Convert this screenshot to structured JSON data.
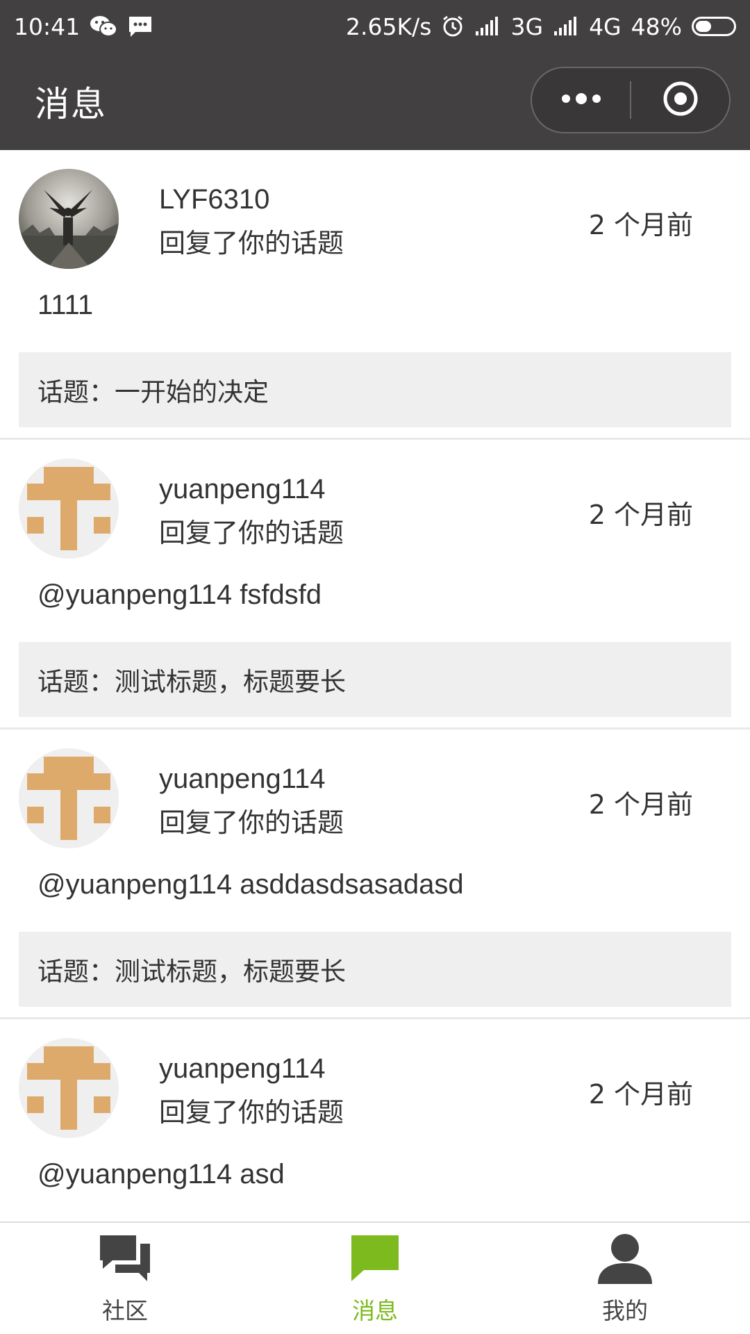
{
  "status_bar": {
    "time": "10:41",
    "net_speed": "2.65K/s",
    "network_1": "3G",
    "network_2": "4G",
    "battery": "48%",
    "battery_level": 0.48,
    "icons": [
      "wechat-icon",
      "sms-icon",
      "alarm-icon",
      "signal-icon",
      "signal-icon"
    ]
  },
  "header": {
    "title": "消息",
    "more_icon": "more-dots-icon",
    "close_icon": "target-circle-icon"
  },
  "messages": [
    {
      "user": "LYF6310",
      "action": "回复了你的话题",
      "time": "2 个月前",
      "content": "1111",
      "topic": "话题：一开始的决定",
      "avatar": "photo-avatar"
    },
    {
      "user": "yuanpeng114",
      "action": "回复了你的话题",
      "time": "2 个月前",
      "content": "@yuanpeng114 fsfdsfd",
      "topic": "话题：测试标题，标题要长",
      "avatar": "identicon-avatar"
    },
    {
      "user": "yuanpeng114",
      "action": "回复了你的话题",
      "time": "2 个月前",
      "content": "@yuanpeng114 asddasdsasadasd",
      "topic": "话题：测试标题，标题要长",
      "avatar": "identicon-avatar"
    },
    {
      "user": "yuanpeng114",
      "action": "回复了你的话题",
      "time": "2 个月前",
      "content": "@yuanpeng114 asd",
      "topic": "",
      "avatar": "identicon-avatar"
    }
  ],
  "tabbar": {
    "tabs": [
      {
        "label": "社区",
        "icon": "community-chat-icon",
        "active": false
      },
      {
        "label": "消息",
        "icon": "message-bubble-icon",
        "active": true
      },
      {
        "label": "我的",
        "icon": "user-profile-icon",
        "active": false
      }
    ]
  },
  "colors": {
    "header_bg": "#434041",
    "accent": "#7cba1e",
    "identicon": "#deaa6c",
    "topic_bg": "#efefef"
  }
}
